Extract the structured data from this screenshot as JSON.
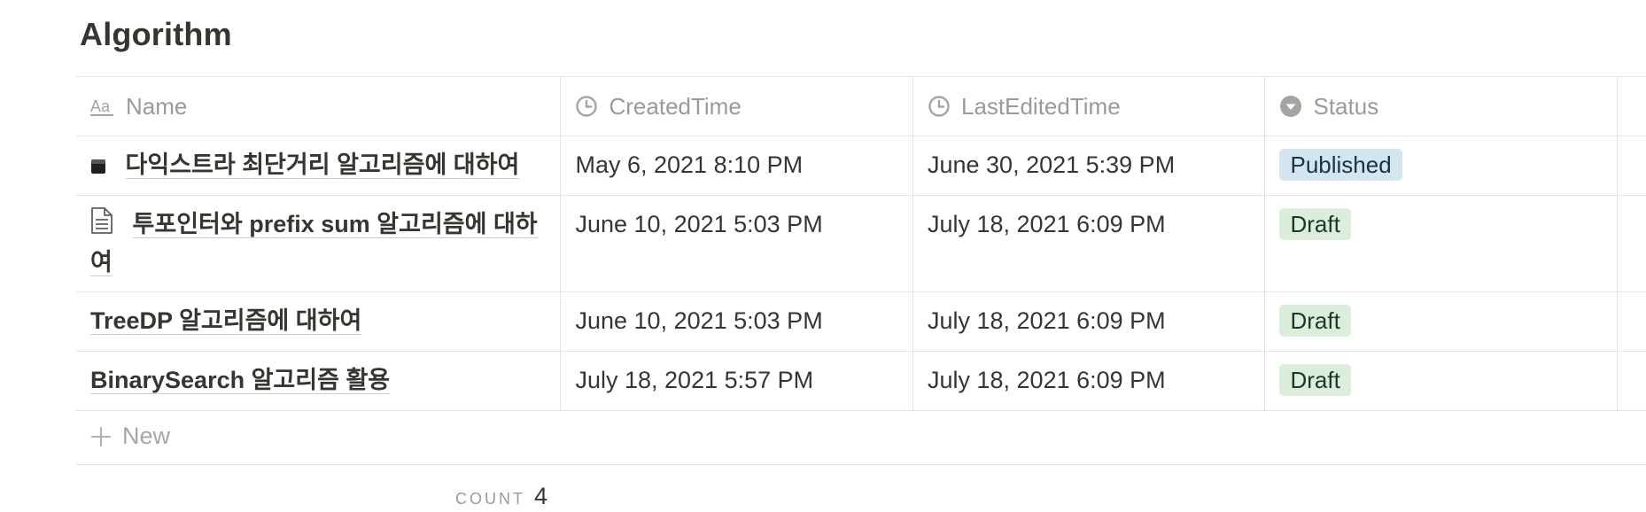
{
  "database": {
    "title": "Algorithm"
  },
  "columns": [
    {
      "label": "Name",
      "icon": "text-property-icon"
    },
    {
      "label": "CreatedTime",
      "icon": "clock-icon"
    },
    {
      "label": "LastEditedTime",
      "icon": "clock-icon"
    },
    {
      "label": "Status",
      "icon": "select-property-icon"
    }
  ],
  "rows": [
    {
      "name": "다익스트라 최단거리 알고리즘에 대하여",
      "icon": "black-square-icon",
      "created": "May 6, 2021 8:10 PM",
      "edited": "June 30, 2021 5:39 PM",
      "status": "Published"
    },
    {
      "name": "투포인터와 prefix sum 알고리즘에 대하여",
      "icon": "document-icon",
      "created": "June 10, 2021 5:03 PM",
      "edited": "July 18, 2021 6:09 PM",
      "status": "Draft"
    },
    {
      "name": "TreeDP 알고리즘에 대하여",
      "icon": "",
      "created": "June 10, 2021 5:03 PM",
      "edited": "July 18, 2021 6:09 PM",
      "status": "Draft"
    },
    {
      "name": "BinarySearch 알고리즘 활용",
      "icon": "",
      "created": "July 18, 2021 5:57 PM",
      "edited": "July 18, 2021 6:09 PM",
      "status": "Draft"
    }
  ],
  "status_colors": {
    "Published": {
      "bg": "#d3e5ef",
      "fg": "#183347"
    },
    "Draft": {
      "bg": "#dbeddb",
      "fg": "#1c3829"
    }
  },
  "new_row": {
    "label": "New"
  },
  "footer": {
    "count_label": "COUNT",
    "count_value": "4"
  }
}
